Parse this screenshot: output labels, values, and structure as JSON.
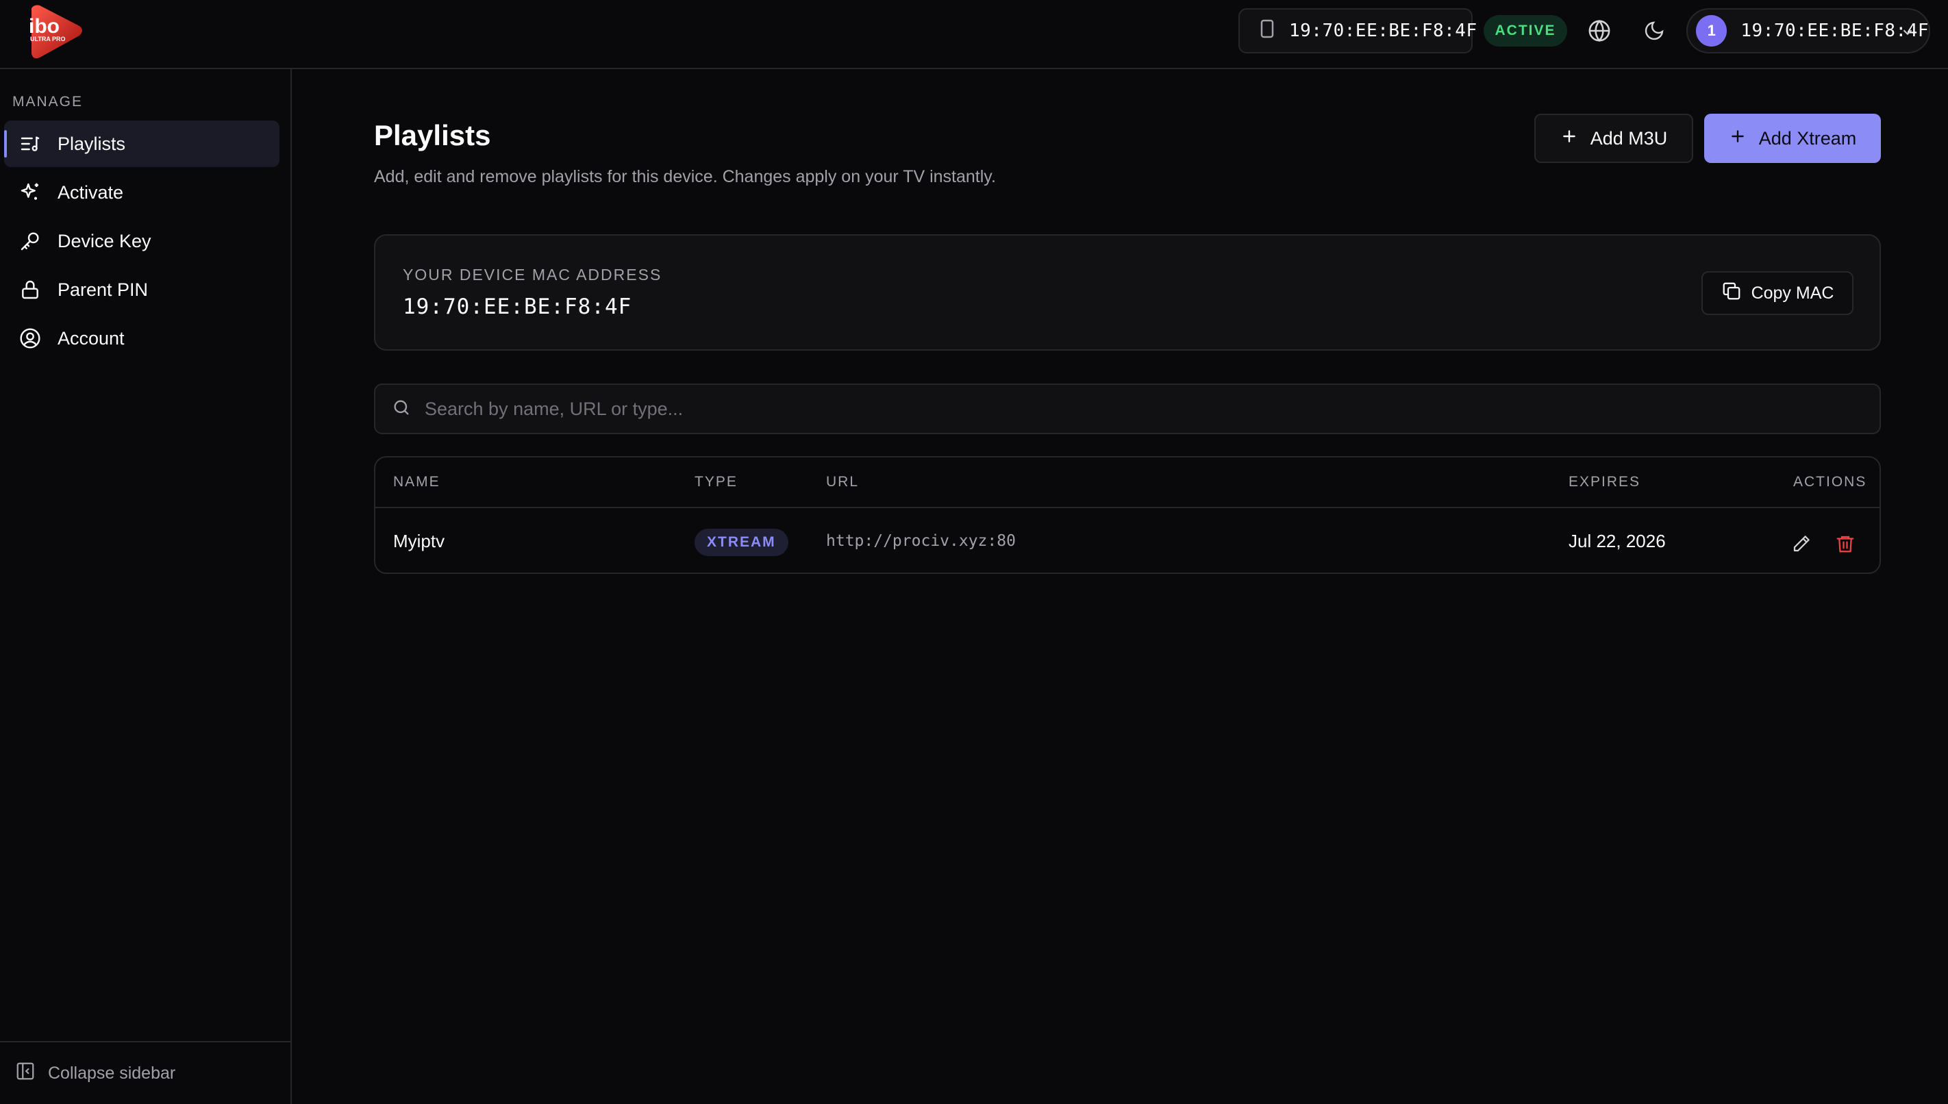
{
  "header": {
    "logo_text": "ibo",
    "logo_sub": "ULTRA PRO",
    "device_mac": "19:70:EE:BE:F8:4F",
    "status": "ACTIVE",
    "account_avatar": "1",
    "account_mac": "19:70:EE:BE:F8:4F",
    "icons": [
      "device-icon",
      "globe-icon",
      "moon-icon",
      "chevron-down-icon"
    ]
  },
  "sidebar": {
    "section": "MANAGE",
    "items": [
      {
        "label": "Playlists",
        "icon": "playlist-icon"
      },
      {
        "label": "Activate",
        "icon": "sparkle-icon"
      },
      {
        "label": "Device Key",
        "icon": "key-icon"
      },
      {
        "label": "Parent PIN",
        "icon": "lock-icon"
      },
      {
        "label": "Account",
        "icon": "user-circle-icon"
      }
    ],
    "selected_index": 0,
    "collapse_label": "Collapse sidebar"
  },
  "main": {
    "title": "Playlists",
    "subtitle": "Add, edit and remove playlists for this device. Changes apply on your TV instantly.",
    "add_m3u": "Add M3U",
    "add_xtream": "Add Xtream",
    "mac_card": {
      "label": "YOUR DEVICE MAC ADDRESS",
      "value": "19:70:EE:BE:F8:4F",
      "copy_label": "Copy MAC"
    },
    "search": {
      "placeholder": "Search by name, URL or type..."
    },
    "table": {
      "columns": [
        "NAME",
        "TYPE",
        "URL",
        "EXPIRES",
        "ACTIONS"
      ],
      "rows": [
        {
          "name": "Myiptv",
          "type": "XTREAM",
          "url": "http://prociv.xyz:80",
          "expires": "Jul 22, 2026"
        }
      ]
    }
  },
  "colors": {
    "background": "#09090b",
    "accent": "#8b8cf6",
    "active": "#4ade80",
    "danger": "#ef4444"
  }
}
